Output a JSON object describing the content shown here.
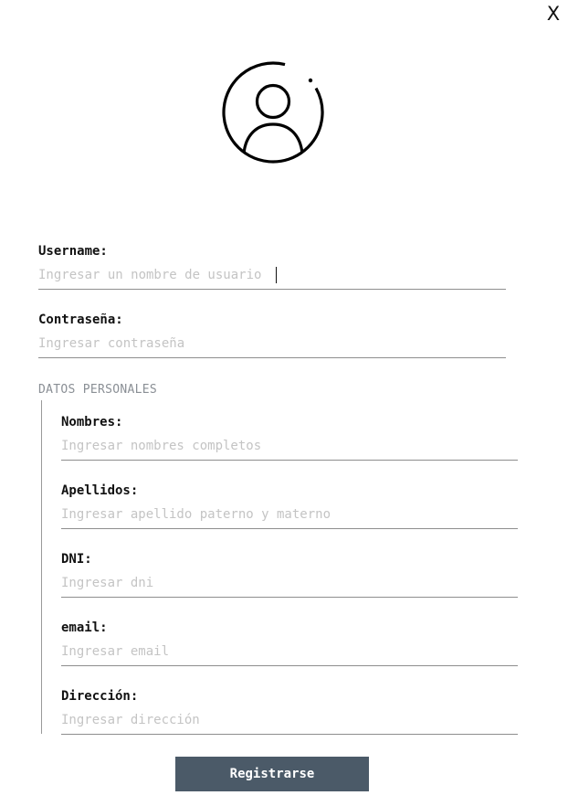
{
  "window": {
    "close_label": "X"
  },
  "avatar": {
    "icon": "user-circle-icon"
  },
  "form": {
    "username": {
      "label": "Username:",
      "placeholder": "Ingresar un nombre de usuario",
      "value": ""
    },
    "password": {
      "label": "Contraseña:",
      "placeholder": "Ingresar contraseña",
      "value": ""
    },
    "personal": {
      "title": "DATOS PERSONALES",
      "nombres": {
        "label": "Nombres:",
        "placeholder": "Ingresar nombres completos",
        "value": ""
      },
      "apellidos": {
        "label": "Apellidos:",
        "placeholder": "Ingresar apellido paterno y materno",
        "value": ""
      },
      "dni": {
        "label": "DNI:",
        "placeholder": "Ingresar dni",
        "value": ""
      },
      "email": {
        "label": "email:",
        "placeholder": "Ingresar email",
        "value": ""
      },
      "direccion": {
        "label": "Dirección:",
        "placeholder": "Ingresar dirección",
        "value": ""
      }
    },
    "submit_label": "Registrarse"
  },
  "colors": {
    "button_bg": "#4b5a68",
    "button_text": "#ffffff",
    "placeholder": "#c4c4c4",
    "section_title": "#8a8f95",
    "underline": "#8e8e8e"
  }
}
